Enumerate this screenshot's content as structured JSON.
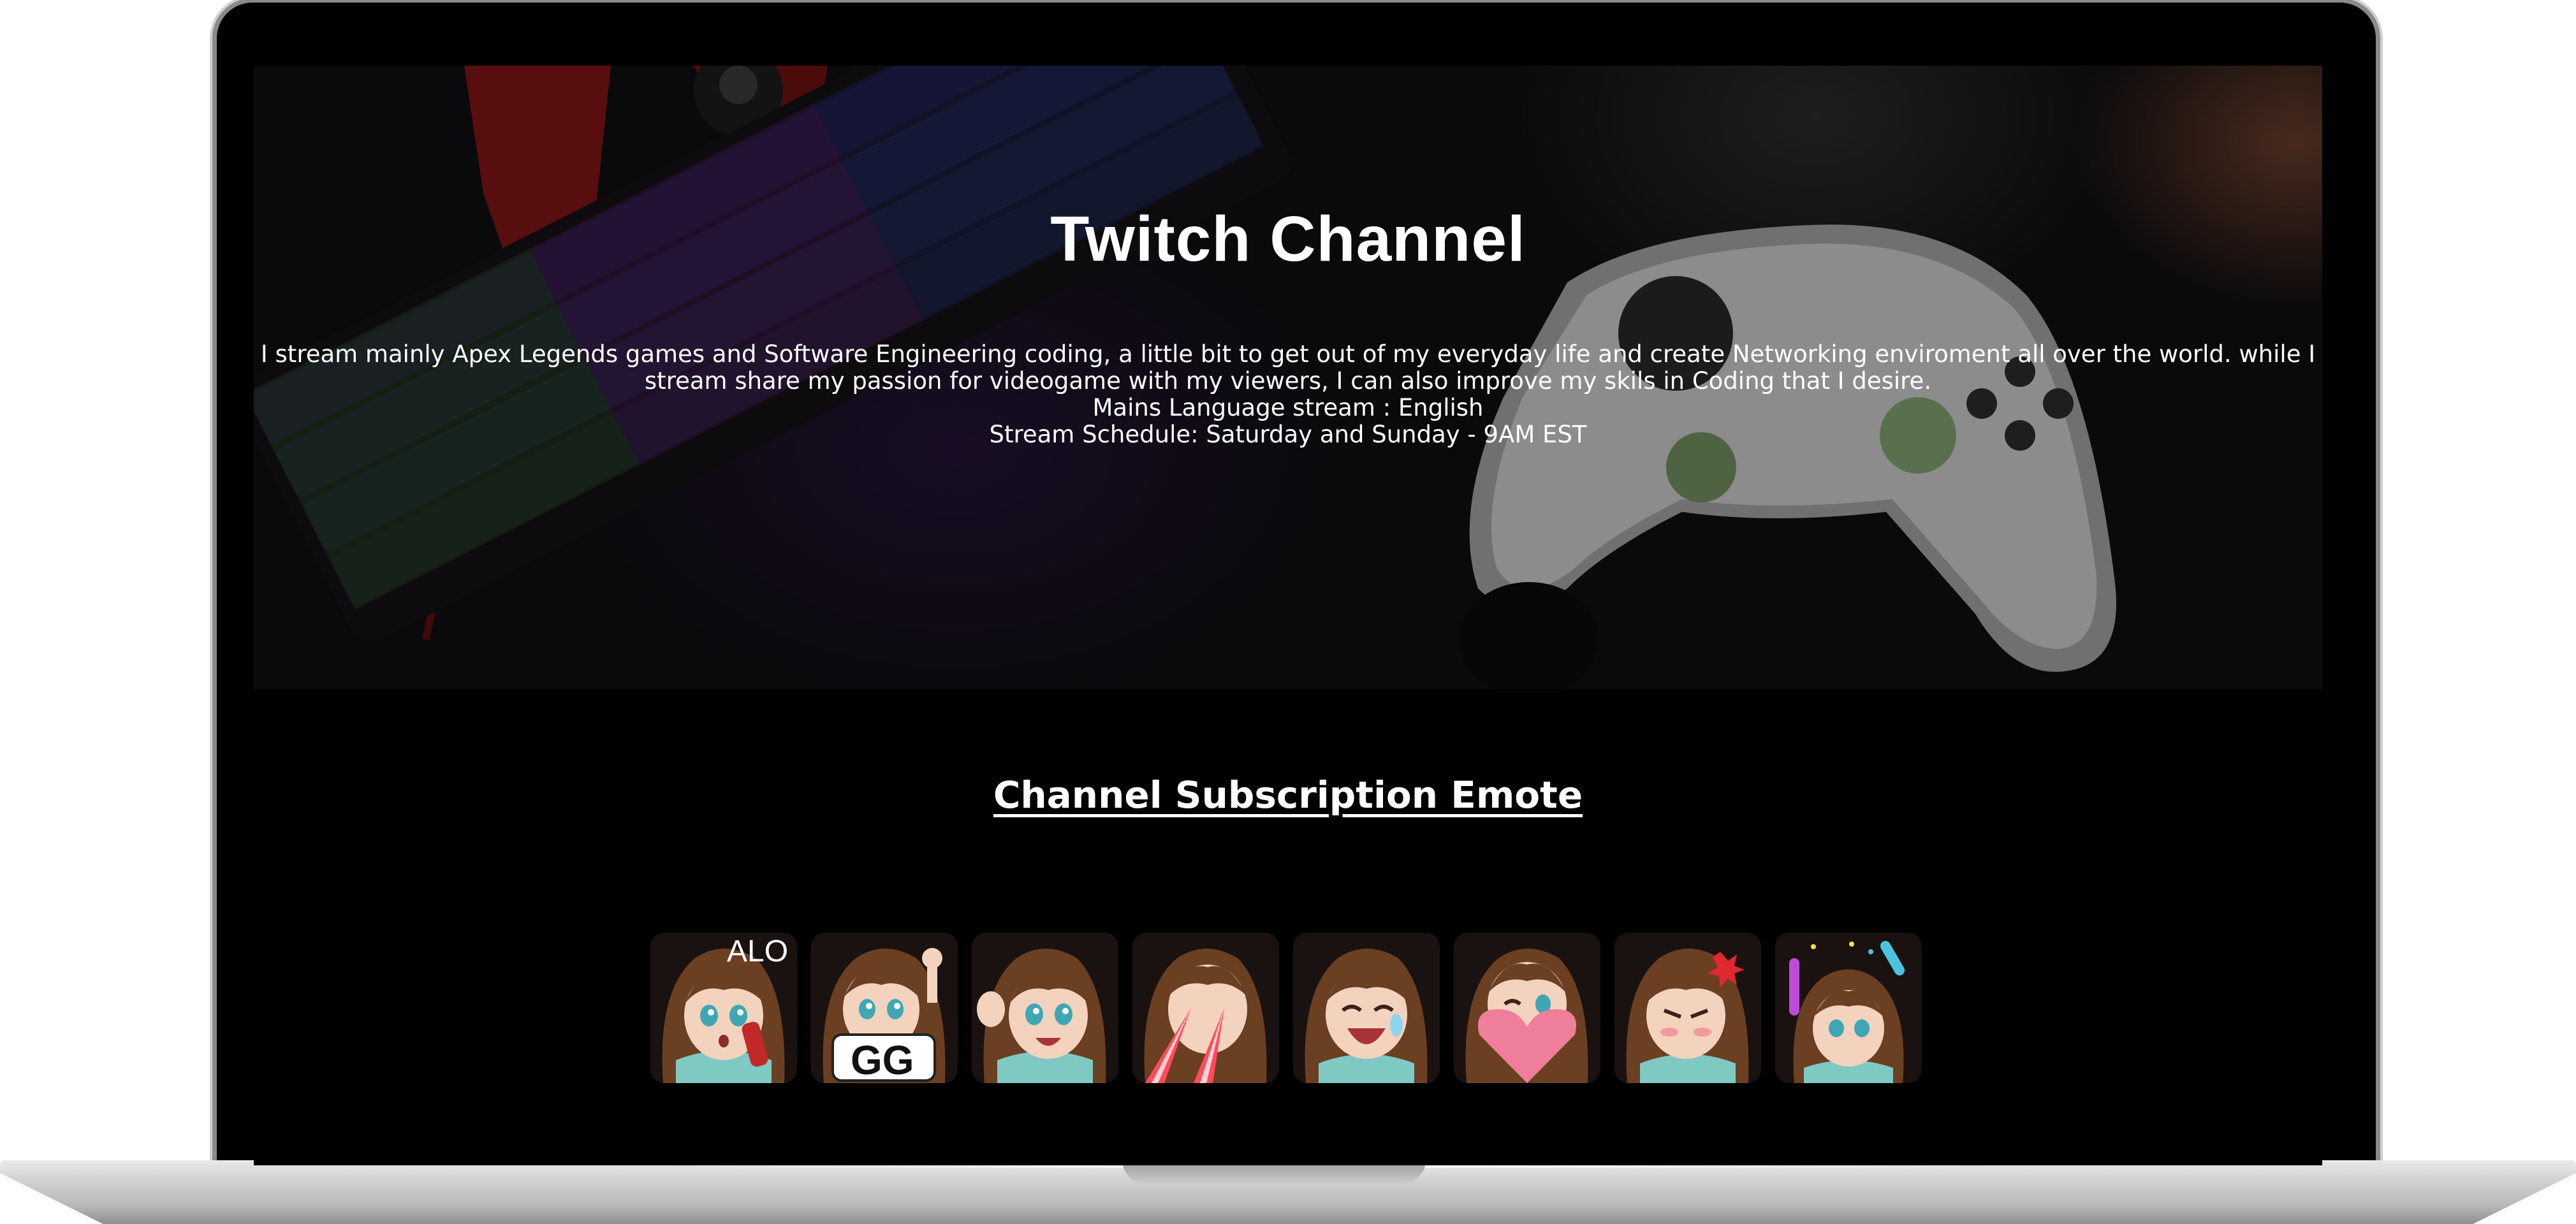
{
  "hero": {
    "title": "Twitch Channel",
    "description_line1": "I stream mainly Apex Legends games and Software Engineering coding, a little bit to get out of my everyday life and create Networking enviroment all over the world. while I",
    "description_line2": "stream share my passion for videogame with my viewers, I can also improve my skils in Coding that I desire.",
    "language": "Mains Language stream : English",
    "schedule": "Stream Schedule: Saturday and Sunday - 9AM EST"
  },
  "emote_section": {
    "title": "Channel Subscription Emote"
  },
  "emotes": [
    {
      "name": "phone",
      "text": "ALO"
    },
    {
      "name": "gg",
      "text": "GG"
    },
    {
      "name": "wave",
      "text": ""
    },
    {
      "name": "laser-eyes",
      "text": ""
    },
    {
      "name": "laugh-cry",
      "text": ""
    },
    {
      "name": "heart",
      "text": ""
    },
    {
      "name": "angry",
      "text": ""
    },
    {
      "name": "lightstick",
      "text": ""
    }
  ],
  "colors": {
    "background": "#000000",
    "text": "#ffffff",
    "hair": "#6b3f22",
    "skin": "#f3d3bd",
    "shirt": "#7fc9c3"
  }
}
